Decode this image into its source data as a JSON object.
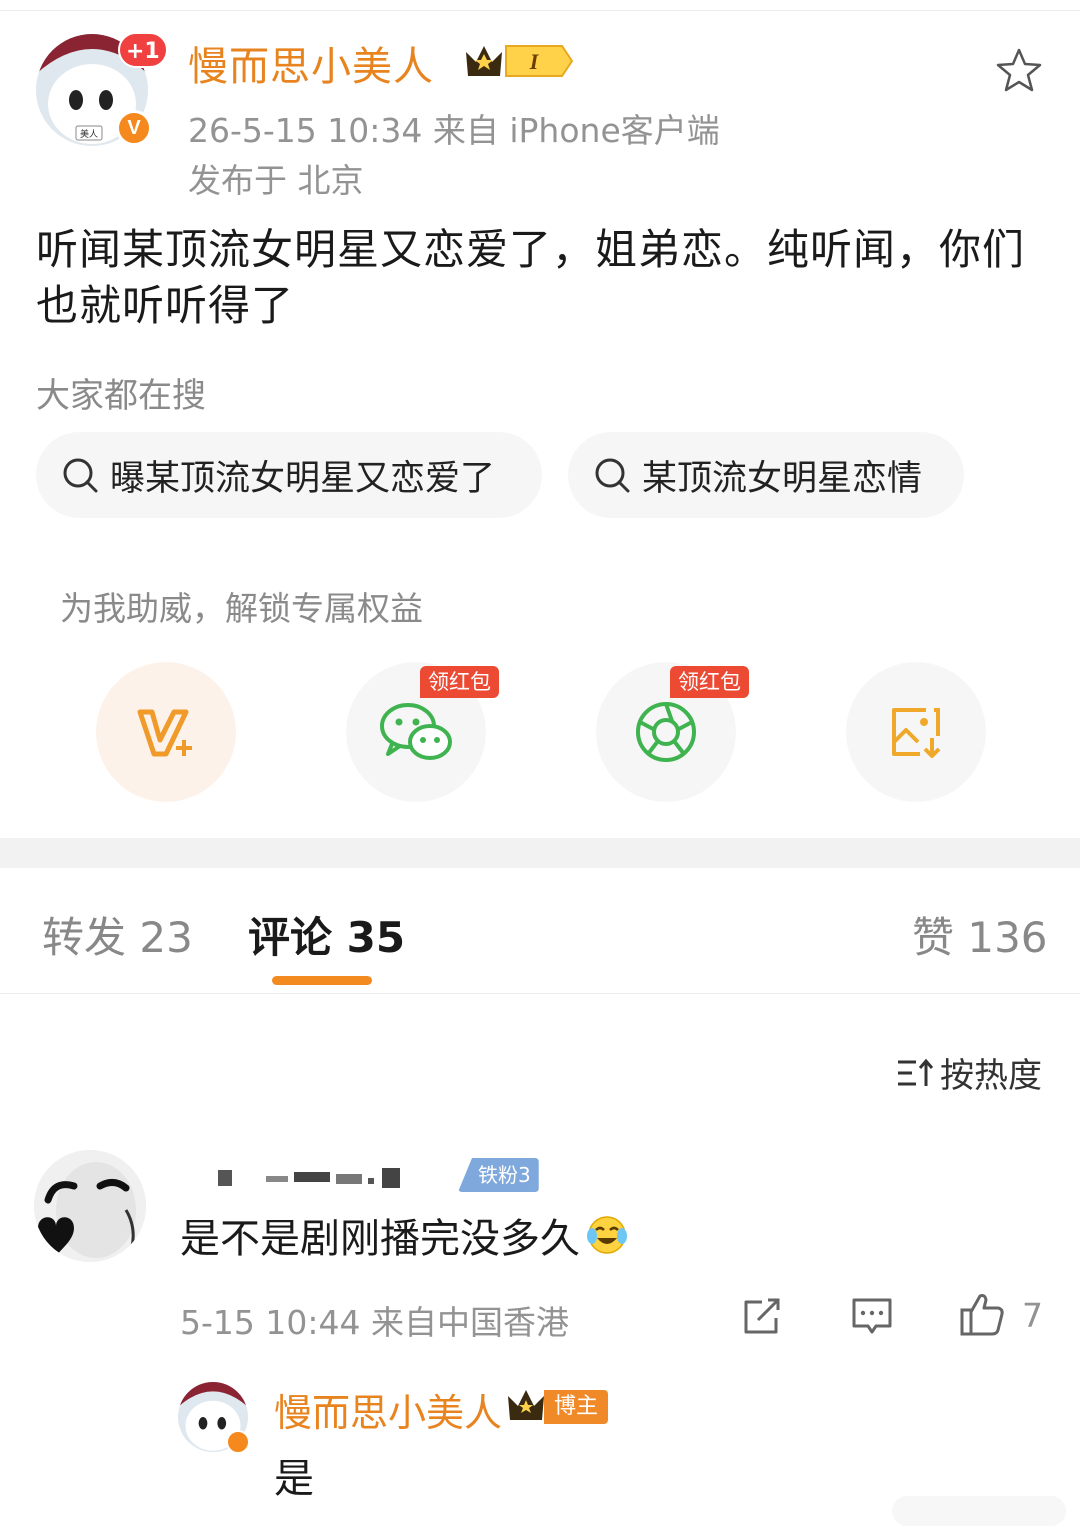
{
  "post": {
    "author": "慢而思小美人",
    "badge_plus": "+1",
    "verified_mark": "V",
    "vip_level": "I",
    "meta": "26-5-15 10:34   来自 iPhone客户端",
    "location": "发布于 北京",
    "body": "听闻某顶流女明星又恋爱了，姐弟恋。纯听闻，你们也就听听得了"
  },
  "trending": {
    "title": "大家都在搜",
    "chips": [
      "曝某顶流女明星又恋爱了",
      "某顶流女明星恋情"
    ]
  },
  "support": {
    "title": "为我助威，解锁专属权益",
    "actions": [
      {
        "icon": "vplus-icon"
      },
      {
        "icon": "wechat-icon",
        "tag": "领红包"
      },
      {
        "icon": "moments-icon",
        "tag": "领红包"
      },
      {
        "icon": "save-image-icon"
      }
    ]
  },
  "tabs": {
    "repost": "转发 23",
    "comments": "评论 35",
    "likes": "赞 136"
  },
  "sort": {
    "label": "按热度"
  },
  "comment": {
    "fan_badge": "铁粉3",
    "text": "是不是剧刚播完没多久",
    "meta": "5-15 10:44  来自中国香港",
    "like_count": "7"
  },
  "reply": {
    "author": "慢而思小美人",
    "badge": "博主",
    "text": "是"
  },
  "colors": {
    "accent": "#e88420",
    "tab_underline": "#f28a1f",
    "red_tag": "#ec4a33",
    "fan_badge": "#7fa8dd"
  }
}
